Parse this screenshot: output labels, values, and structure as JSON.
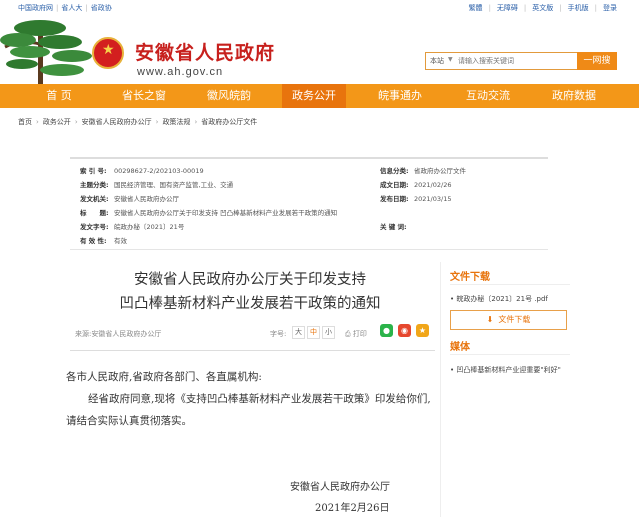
{
  "topbar": {
    "left_links": [
      "中国政府网",
      "省人大",
      "省政协"
    ],
    "right_links": [
      "繁體",
      "无障碍",
      "英文版",
      "手机版",
      "登录"
    ]
  },
  "header": {
    "site_title": "安徽省人民政府",
    "site_url": "www.ah.gov.cn",
    "search": {
      "scope": "本站",
      "placeholder": "请输入搜索关键词",
      "button": "一网搜"
    }
  },
  "nav": {
    "items": [
      "首 页",
      "省长之窗",
      "徽风皖韵",
      "政务公开",
      "皖事通办",
      "互动交流",
      "政府数据"
    ],
    "active_index": 3
  },
  "breadcrumb": [
    "首页",
    "政务公开",
    "安徽省人民政府办公厅",
    "政策法规",
    "省政府办公厅文件"
  ],
  "info": {
    "index_label": "索 引 号:",
    "index_value": "00298627-2/202103-00019",
    "category_label": "信息分类:",
    "category_value": "省政府办公厅文件",
    "topic_label": "主题分类:",
    "topic_value": "国民经济管理、国有资产监管,工业、交通",
    "date_label": "成文日期:",
    "date_value": "2021/02/26",
    "org_label": "发文机关:",
    "org_value": "安徽省人民政府办公厅",
    "pubdate_label": "发布日期:",
    "pubdate_value": "2021/03/15",
    "title_label": "标　　题:",
    "title_value": "安徽省人民政府办公厅关于印发支持 凹凸棒基新材料产业发展若干政策的通知",
    "docno_label": "发文字号:",
    "docno_value": "皖政办秘〔2021〕21号",
    "keywords_label": "关 键 词:",
    "keywords_value": "",
    "valid_label": "有 效 性:",
    "valid_value": "有效"
  },
  "article": {
    "title_line1": "安徽省人民政府办公厅关于印发支持",
    "title_line2": "凹凸棒基新材料产业发展若干政策的通知",
    "source": "来源:安徽省人民政府办公厅",
    "fontsize_label": "字号:",
    "sizes": [
      "大",
      "中",
      "小"
    ],
    "print": "打印",
    "salutation": "各市人民政府,省政府各部门、各直属机构:",
    "body": "经省政府同意,现将《支持凹凸棒基新材料产业发展若干政策》印发给你们,请结合实际认真贯彻落实。",
    "signature": "安徽省人民政府办公厅",
    "sign_date": "2021年2月26日"
  },
  "sidebar": {
    "download_title": "文件下载",
    "file_name": "皖政办秘〔2021〕21号 .pdf",
    "download_button": "文件下载",
    "media_title": "媒体",
    "media_item": "凹凸棒基新材料产业迎重要\"利好\""
  },
  "colors": {
    "accent": "#f39718",
    "accent_dark": "#e8740d",
    "title_red": "#c7201d",
    "link_blue": "#2a5fa8"
  }
}
